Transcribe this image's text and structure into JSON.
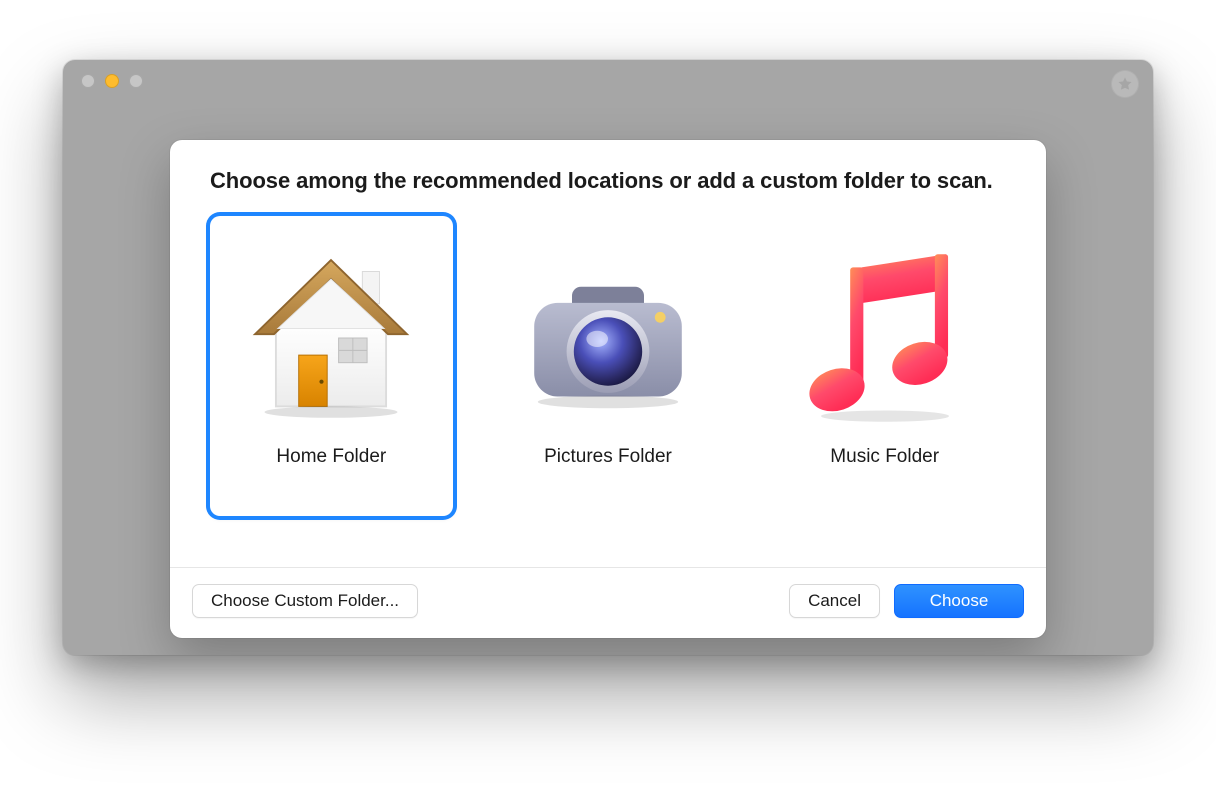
{
  "colors": {
    "window_bg": "#a6a6a6",
    "selection": "#1e86ff",
    "primary_button": "#1f82ff"
  },
  "traffic_lights": {
    "close": "inactive",
    "minimize": "active",
    "zoom": "inactive"
  },
  "toolbar": {
    "star_icon": "star-icon"
  },
  "sheet": {
    "title": "Choose among the recommended locations or add a custom folder to scan.",
    "options": [
      {
        "id": "home",
        "label": "Home Folder",
        "icon": "home-folder-icon",
        "selected": true
      },
      {
        "id": "pictures",
        "label": "Pictures Folder",
        "icon": "pictures-folder-icon",
        "selected": false
      },
      {
        "id": "music",
        "label": "Music Folder",
        "icon": "music-folder-icon",
        "selected": false
      }
    ],
    "buttons": {
      "custom_label": "Choose Custom Folder...",
      "cancel_label": "Cancel",
      "choose_label": "Choose"
    }
  }
}
